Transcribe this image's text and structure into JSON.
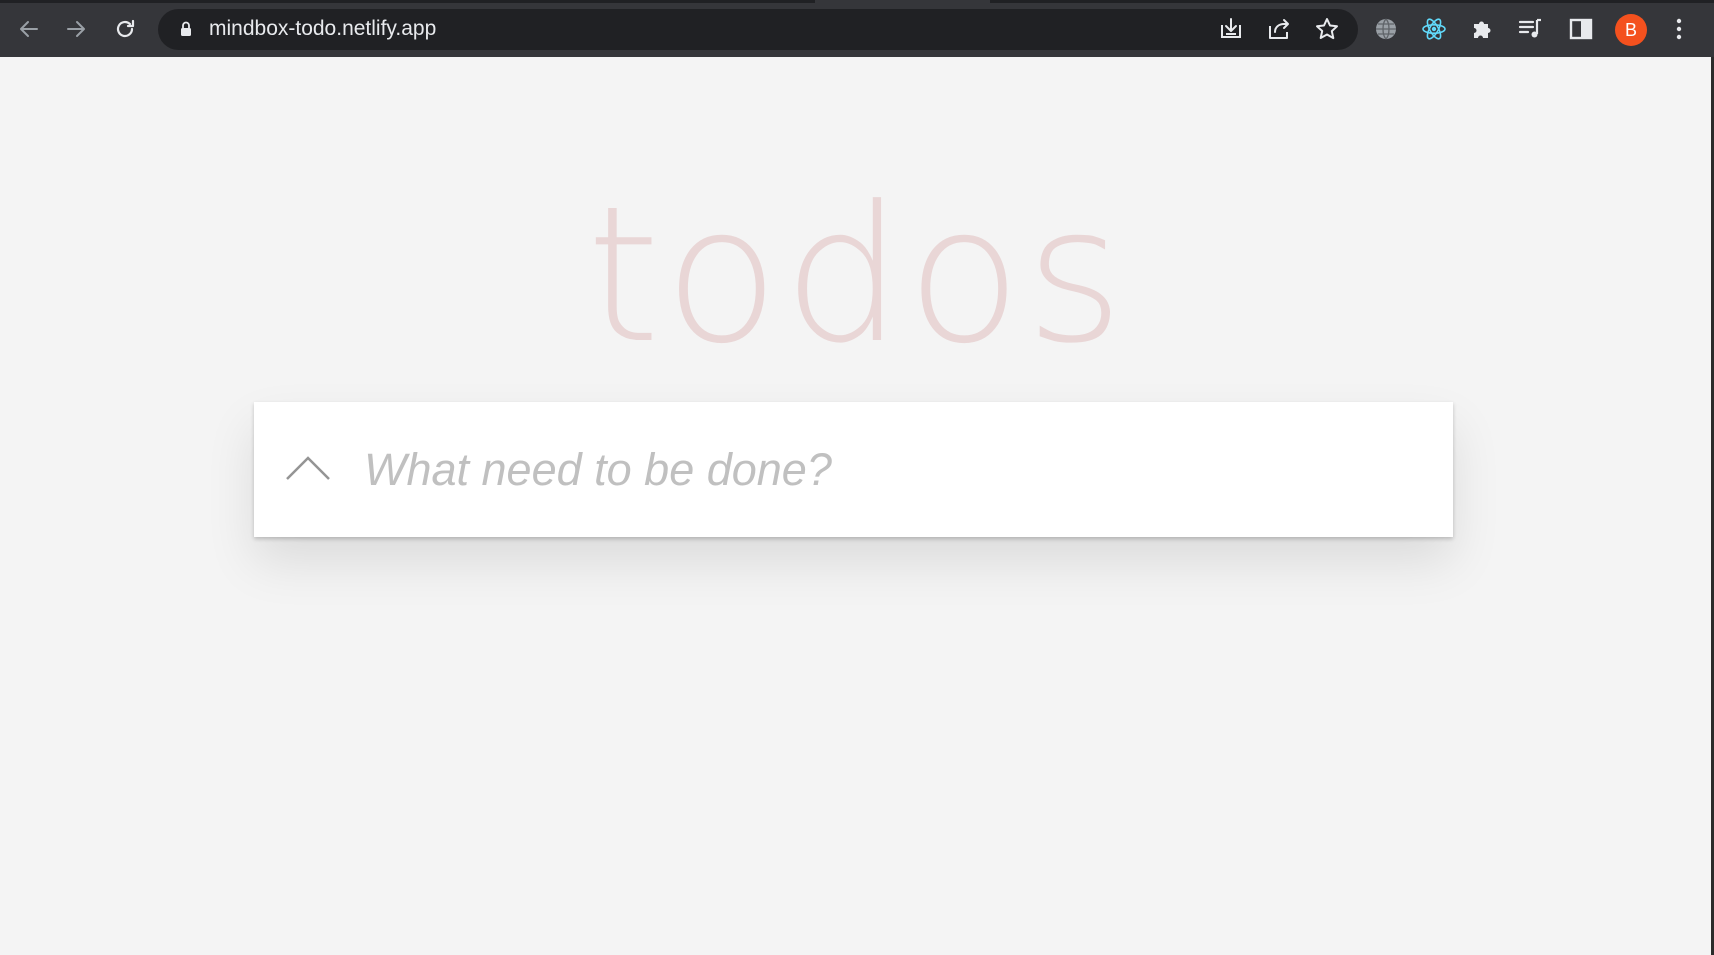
{
  "browser": {
    "url": "mindbox-todo.netlify.app",
    "avatar_letter": "B",
    "avatar_color": "#f4511e",
    "nav": {
      "back_icon": "arrow-left-icon",
      "forward_icon": "arrow-right-icon",
      "reload_icon": "reload-icon"
    },
    "omnibox_actions": [
      "install-icon",
      "share-icon",
      "bookmark-star-icon"
    ],
    "extensions": [
      "globe-icon",
      "react-icon",
      "puzzle-icon",
      "media-queue-icon",
      "side-panel-icon"
    ],
    "menu_icon": "kebab-menu-icon"
  },
  "app": {
    "title": "todos",
    "title_color": "#efd5d5",
    "new_todo": {
      "placeholder": "What need to be done?",
      "value": ""
    },
    "toggle_all_icon": "chevron-up-icon"
  }
}
